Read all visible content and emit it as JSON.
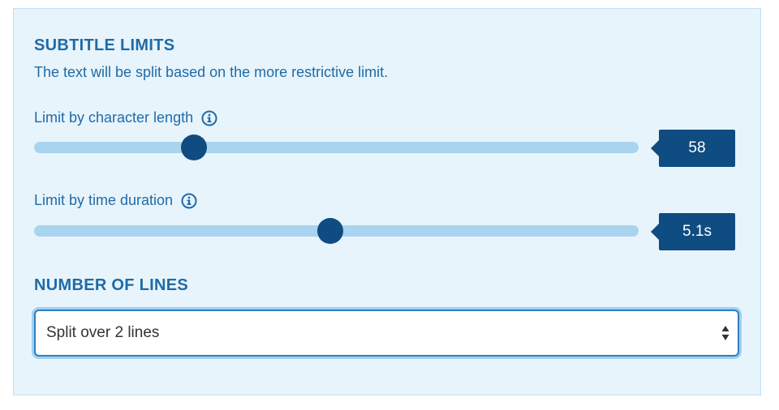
{
  "subtitle_limits": {
    "heading": "SUBTITLE LIMITS",
    "description": "The text will be split based on the more restrictive limit.",
    "character_length": {
      "label": "Limit by character length",
      "value_text": "58",
      "slider_fraction": 0.265
    },
    "time_duration": {
      "label": "Limit by time duration",
      "value_text": "5.1s",
      "slider_fraction": 0.49
    }
  },
  "number_of_lines": {
    "heading": "NUMBER OF LINES",
    "selected": "Split over 2 lines"
  },
  "colors": {
    "accent": "#1e6ba8",
    "thumb": "#0f4c81",
    "track": "#a9d4ef",
    "panel_bg": "#e8f4fb"
  },
  "icons": {
    "info": "info-icon",
    "select_arrows": "updown-arrows-icon"
  }
}
